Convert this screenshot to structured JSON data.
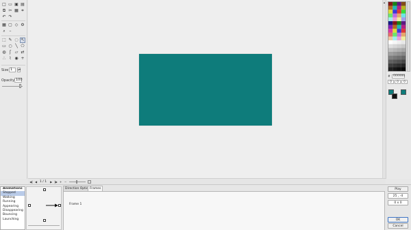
{
  "toolbox": {
    "tool_rows_top": [
      [
        "new-file-icon",
        "open-folder-icon",
        "save-icon",
        "save-as-icon"
      ],
      [
        "copy-icon",
        "cut-icon",
        "paste-icon",
        "crop-icon"
      ],
      [
        "undo-icon",
        "redo-icon"
      ]
    ],
    "tool_rows_mid": [
      [
        "grid-icon",
        "frame-icon",
        "diamond-icon",
        "gear-icon"
      ],
      [
        "zoom-icon",
        "zoom-slider-icon"
      ]
    ],
    "tool_rows_draw": [
      [
        "rect-select-icon",
        "pencil-icon",
        "lasso-icon",
        "pointer-icon"
      ],
      [
        "rectangle-icon",
        "ellipse-icon",
        "line-icon",
        "polygon-icon"
      ],
      [
        "fill-icon",
        "brush-icon",
        "eraser-icon",
        "replace-icon"
      ],
      [
        "spray-icon",
        "dropper-icon",
        "eye-icon",
        "plus-icon"
      ]
    ],
    "size_label": "Size",
    "size_value": "1",
    "opacity_label": "Opacity",
    "opacity_value": "100"
  },
  "frame_controls": {
    "first": "◀|",
    "prev": "◀",
    "counter": "1 / 1",
    "next": "▶",
    "last": "|▶",
    "add": "+",
    "delete": "−"
  },
  "palette": {
    "hex_label": "#",
    "hex_value": "000000",
    "rgb": [
      "0",
      "0",
      "0"
    ],
    "primary_color": "#0e7c7b",
    "secondary_color": "#111111",
    "tertiary_color": "#0e7c7b"
  },
  "animations": {
    "header": "Animations",
    "items": [
      "Stopped",
      "Walking",
      "Running",
      "Appearing",
      "Disappearing",
      "Bouncing",
      "Launching"
    ],
    "selected_index": 0
  },
  "tabs": {
    "direction_options": "Direction Options",
    "frames": "Frames",
    "active": "frames",
    "content_line": "Frame 1"
  },
  "canvas": {
    "fill_color": "#0e7c7b"
  },
  "buttons": {
    "play": "Play",
    "offset": "25 , -4",
    "size": "0 x 0",
    "ok": "OK",
    "cancel": "Cancel"
  }
}
